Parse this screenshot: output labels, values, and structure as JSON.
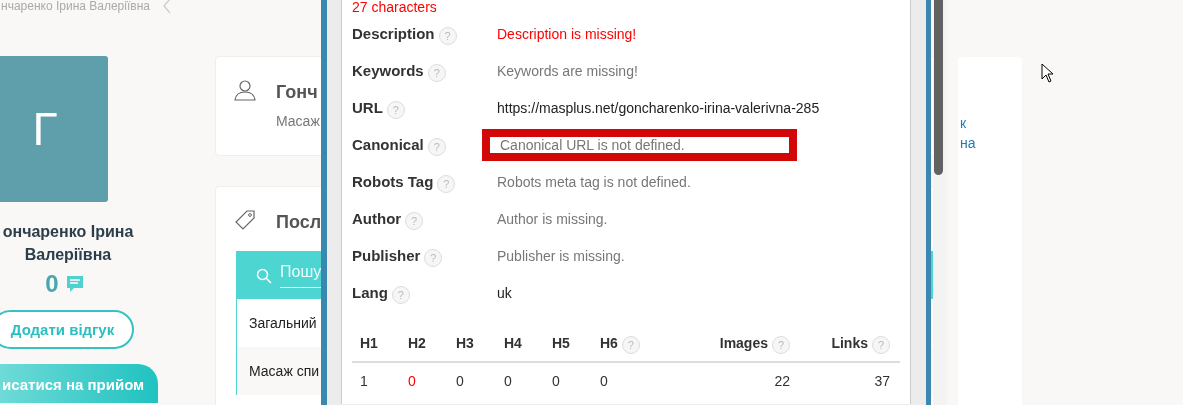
{
  "breadcrumb": {
    "text": "нчаренко Ірина Валеріївна"
  },
  "profile": {
    "initial": "Г",
    "name": "ончаренко Ірина Валеріївна",
    "reviews_count": "0",
    "buttons": [
      {
        "label": "Додати відгук",
        "kind": "outline"
      },
      {
        "label": "исатися на прийом",
        "kind": "filled"
      }
    ]
  },
  "cards": [
    {
      "kind": "person",
      "title": "Гонч",
      "subtitle": "Масаж"
    },
    {
      "kind": "services",
      "title": "Посл",
      "search": {
        "placeholder": "Пошу"
      },
      "items": [
        "Загальний",
        "Масаж спи"
      ]
    }
  ],
  "side_card": {
    "lines": [
      "к",
      "на"
    ]
  },
  "seo_panel": {
    "title_length": "27 characters",
    "rows": [
      {
        "label": "Description",
        "help": "?",
        "value": "Description is missing!",
        "kind": "error",
        "highlighted": false
      },
      {
        "label": "Keywords",
        "help": "?",
        "value": "Keywords are missing!",
        "kind": "missing",
        "highlighted": false
      },
      {
        "label": "URL",
        "help": "?",
        "value": "https://masplus.net/goncharenko-irina-valerivna-285",
        "kind": "ok",
        "highlighted": false
      },
      {
        "label": "Canonical",
        "help": "?",
        "value": "Canonical URL is not defined.",
        "kind": "missing",
        "highlighted": true
      },
      {
        "label": "Robots Tag",
        "help": "?",
        "value": "Robots meta tag is not defined.",
        "kind": "missing",
        "highlighted": false
      },
      {
        "label": "Author",
        "help": "?",
        "value": "Author is missing.",
        "kind": "missing",
        "highlighted": false
      },
      {
        "label": "Publisher",
        "help": "?",
        "value": "Publisher is missing.",
        "kind": "missing",
        "highlighted": false
      },
      {
        "label": "Lang",
        "help": "?",
        "value": "uk",
        "kind": "ok",
        "highlighted": false
      }
    ],
    "stats": [
      {
        "label": "H1",
        "value": "1",
        "error": false
      },
      {
        "label": "H2",
        "value": "0",
        "error": true
      },
      {
        "label": "H3",
        "value": "0",
        "error": false
      },
      {
        "label": "H4",
        "value": "0",
        "error": false
      },
      {
        "label": "H5",
        "value": "0",
        "error": false
      },
      {
        "label": "H6",
        "help": "?",
        "value": "0",
        "error": false
      },
      {
        "label": "Images",
        "help": "?",
        "value": "22",
        "error": false
      },
      {
        "label": "Links",
        "help": "?",
        "value": "37",
        "error": false
      }
    ]
  }
}
